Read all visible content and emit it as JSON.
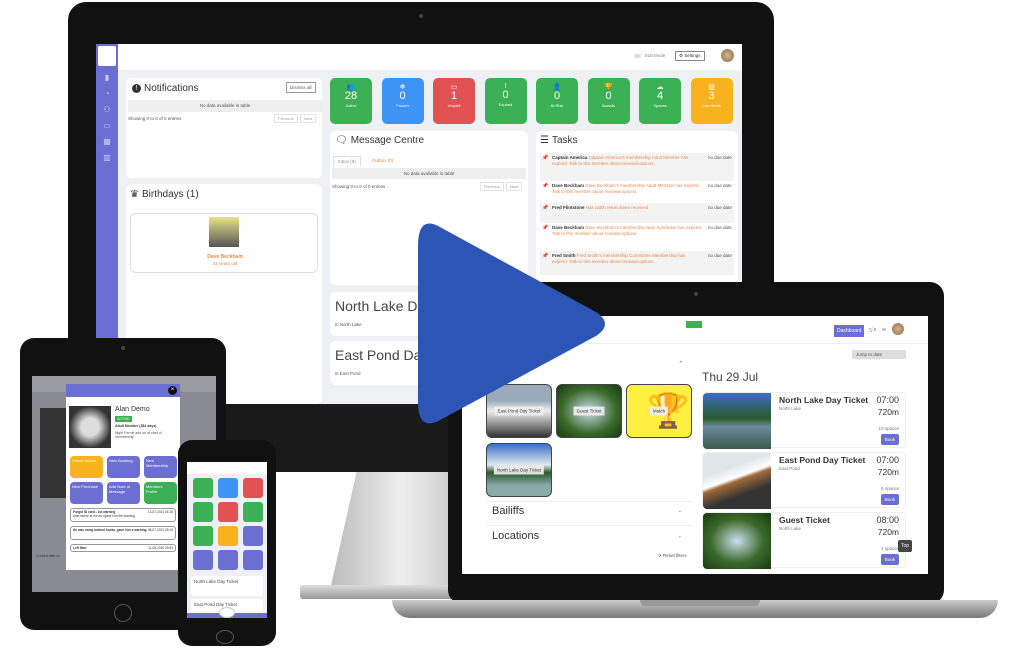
{
  "monitor": {
    "topbar": {
      "edit_mode_label": "Edit Mode",
      "settings_label": "Settings"
    },
    "sidebar": {
      "icons": [
        "bookmark-icon",
        "dashboard-icon",
        "members-icon",
        "ticket-icon",
        "calendar-icon",
        "chart-icon"
      ]
    },
    "notifications": {
      "title": "Notifications",
      "dismiss_label": "Dismiss all",
      "empty_text": "No data available in table",
      "info": "Showing 0 to 0 of 0 entries",
      "prev": "Previous",
      "next": "Next"
    },
    "birthdays": {
      "title": "Birthdays (1)",
      "person": {
        "name": "Dave Beckham",
        "age": "41 years old"
      }
    },
    "stat_tiles": [
      {
        "label": "Active",
        "value": "28",
        "icon": "members-icon",
        "color": "#3cb054"
      },
      {
        "label": "Frozen",
        "value": "0",
        "icon": "snowflake-icon",
        "color": "#3d94f5"
      },
      {
        "label": "Unpaid",
        "value": "1",
        "icon": "money-icon",
        "color": "#e35252"
      },
      {
        "label": "Expired",
        "value": "0",
        "icon": "exclamation-icon",
        "color": "#3cb054"
      },
      {
        "label": "At Risk",
        "value": "0",
        "icon": "user-alert-icon",
        "color": "#3cb054"
      },
      {
        "label": "Awards",
        "value": "0",
        "icon": "trophy-icon",
        "color": "#3cb054"
      },
      {
        "label": "Spaces",
        "value": "4",
        "icon": "cloud-icon",
        "color": "#3cb054"
      },
      {
        "label": "Low Stock",
        "value": "3",
        "icon": "chart-icon",
        "color": "#f7b21e"
      }
    ],
    "messages": {
      "title": "Message Centre",
      "tabs": [
        "Inbox (0)",
        "Outbox (0)"
      ],
      "empty_text": "No data available in table",
      "info": "Showing 0 to 0 of 0 entries",
      "prev": "Previous",
      "next": "Next"
    },
    "tasks": {
      "title": "Tasks",
      "items": [
        {
          "who": "Captain America",
          "text": "Captain America's membership Adult Member has expired. Talk to this member about renewal options.",
          "due": "no due date"
        },
        {
          "who": "Dave Beckham",
          "text": "Dave Beckham's membership Adult Member has expired. Talk to this member about renewal options.",
          "due": "no due date"
        },
        {
          "who": "Fred Flintstone",
          "text": "Has catch return been received",
          "due": "no due date"
        },
        {
          "who": "Dave Beckham",
          "text": "Dave Beckham's membership New Syndicate has expired. Talk to this member about renewal options.",
          "due": "no due date"
        },
        {
          "who": "Fred Smith",
          "text": "Fred Smith's membership Committee Membership has expired. Talk to this member about renewal options.",
          "due": "no due date"
        }
      ]
    },
    "venues": [
      {
        "title": "North Lake Day Ticket",
        "sub": "in North Lake"
      },
      {
        "title": "East Pond Day Ticket",
        "sub": "in East Pond"
      }
    ]
  },
  "laptop": {
    "dashboard_label": "Dashboard",
    "cart_count": "0",
    "jump_label": "Jump to date",
    "date_heading": "Thu 29 Jul",
    "categories": [
      "East Pond Day Ticket",
      "Guest Ticket",
      "Match",
      "North Lake Day Ticket"
    ],
    "filters": [
      "Bailiffs",
      "Locations"
    ],
    "reset_label": "Reset filters",
    "tickets": [
      {
        "name": "North Lake Day Ticket",
        "location": "North Lake",
        "time": "07:00",
        "duration": "720m",
        "spaces": "10 spaces",
        "book": "Book"
      },
      {
        "name": "East Pond Day Ticket",
        "location": "East Pond",
        "time": "07:00",
        "duration": "720m",
        "spaces": "5 spaces",
        "book": "Book"
      },
      {
        "name": "Guest Ticket",
        "location": "North Lake",
        "time": "08:00",
        "duration": "720m",
        "spaces": "4 spaces",
        "book": "Book"
      }
    ],
    "top_label": "Top"
  },
  "tablet": {
    "member": {
      "name": "Alan Demo",
      "status": "ACTIVE",
      "membership": "Adult Member (284 days)",
      "note": "Night Permit add-on at start of membership"
    },
    "actions": [
      {
        "label": "Check-In/Out",
        "color": "#f7b21e"
      },
      {
        "label": "New Booking",
        "color": "#6b6fd4"
      },
      {
        "label": "New Membership",
        "color": "#6b6fd4"
      },
      {
        "label": "New Purchase",
        "color": "#6b6fd4"
      },
      {
        "label": "Add Note or Message",
        "color": "#6b6fd4"
      },
      {
        "label": "Members Profile",
        "color": "#3cb054"
      }
    ],
    "notes": [
      {
        "title": "Forgot ID card - 1st warning",
        "body": "Alan swore at me as I gave him the warning.",
        "date": "13-07-2021 04:18",
        "by": "Owen Test"
      },
      {
        "title": "He was using barbed hooks, gave him a warning.",
        "body": "",
        "date": "08-07-2021 05:13",
        "by": "Owen Test"
      },
      {
        "title": "Left litter",
        "body": "",
        "date": "11-08-2020 09:53",
        "by": ""
      }
    ],
    "contact_label": "Contact with us"
  },
  "phone": {
    "tile_colors": [
      "#3cb054",
      "#3d94f5",
      "#e35252",
      "#3cb054",
      "#e35252",
      "#3cb054",
      "#3cb054",
      "#f7b21e",
      "#6b6fd4",
      "#6b6fd4",
      "#6b6fd4",
      "#6b6fd4"
    ],
    "venues": [
      "North Lake Day Ticket",
      "East Pond Day Ticket"
    ]
  },
  "overlay": {
    "play_color": "#2c55b6"
  }
}
